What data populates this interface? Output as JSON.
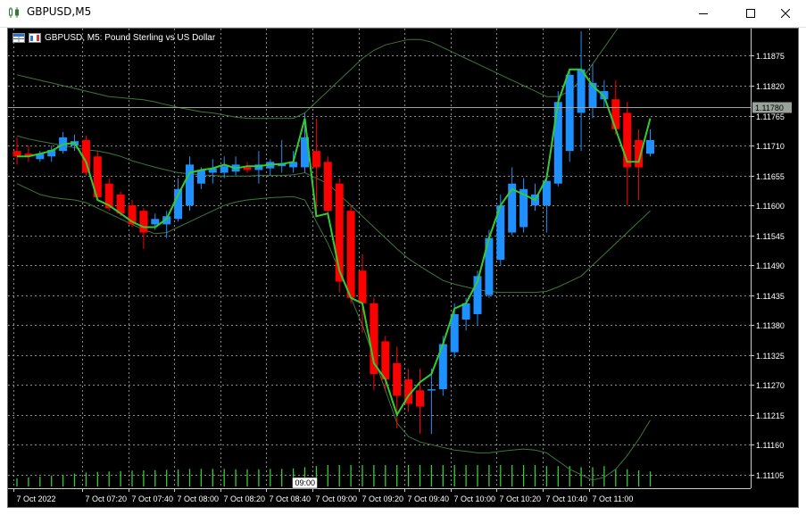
{
  "window": {
    "title": "GBPUSD,M5",
    "minimize_icon": "minimize-icon",
    "maximize_icon": "maximize-icon",
    "close_icon": "close-icon"
  },
  "chart_header": {
    "symbol_text": "GBPUSD, M5:  Pound Sterling vs US Dollar",
    "icons": [
      "trade-panel-icon",
      "one-click-trading-icon"
    ]
  },
  "colors": {
    "background": "#000000",
    "grid": "#8a8a8a",
    "bull": "#1e90ff",
    "bear": "#ff0000",
    "ma": "#32cd32",
    "bands": "#3c783c",
    "volume": "#32cd32",
    "price_line": "#9aa39a",
    "axis_text": "#ffffff"
  },
  "chart_data": {
    "type": "candlestick",
    "symbol": "GBPUSD",
    "timeframe": "M5",
    "current_price": "1.11780",
    "ylim": [
      1.1108,
      1.11925
    ],
    "y_ticks": [
      "1.11875",
      "1.11820",
      "1.11765",
      "1.11710",
      "1.11655",
      "1.11600",
      "1.11545",
      "1.11490",
      "1.11435",
      "1.11380",
      "1.11325",
      "1.11270",
      "1.11215",
      "1.11160",
      "1.11105"
    ],
    "x_ticks": [
      {
        "label": "7 Oct 2022",
        "bar": 0
      },
      {
        "label": "7 Oct 07:20",
        "bar": 6
      },
      {
        "label": "7 Oct 07:40",
        "bar": 10
      },
      {
        "label": "7 Oct 08:00",
        "bar": 14
      },
      {
        "label": "7 Oct 08:20",
        "bar": 18
      },
      {
        "label": "7 Oct 08:40",
        "bar": 22
      },
      {
        "label": "7 Oct 09:00",
        "bar": 26
      },
      {
        "label": "7 Oct 09:20",
        "bar": 30
      },
      {
        "label": "7 Oct 09:40",
        "bar": 34
      },
      {
        "label": "7 Oct 10:00",
        "bar": 38
      },
      {
        "label": "7 Oct 10:20",
        "bar": 42
      },
      {
        "label": "7 Oct 10:40",
        "bar": 46
      },
      {
        "label": "7 Oct 11:00",
        "bar": 50
      }
    ],
    "crosshair_time_label": "09:00",
    "crosshair_bar": 25,
    "candles": [
      {
        "o": 1.117,
        "h": 1.11725,
        "l": 1.11675,
        "c": 1.1169
      },
      {
        "o": 1.11695,
        "h": 1.1171,
        "l": 1.1168,
        "c": 1.1169
      },
      {
        "o": 1.11685,
        "h": 1.117,
        "l": 1.1168,
        "c": 1.11695
      },
      {
        "o": 1.1169,
        "h": 1.1171,
        "l": 1.1168,
        "c": 1.11702
      },
      {
        "o": 1.117,
        "h": 1.11735,
        "l": 1.11695,
        "c": 1.11725
      },
      {
        "o": 1.1171,
        "h": 1.1173,
        "l": 1.117,
        "c": 1.11718
      },
      {
        "o": 1.1172,
        "h": 1.11728,
        "l": 1.11655,
        "c": 1.1166
      },
      {
        "o": 1.1169,
        "h": 1.117,
        "l": 1.1161,
        "c": 1.11615
      },
      {
        "o": 1.1164,
        "h": 1.1165,
        "l": 1.1159,
        "c": 1.11595
      },
      {
        "o": 1.1162,
        "h": 1.11625,
        "l": 1.1158,
        "c": 1.11585
      },
      {
        "o": 1.116,
        "h": 1.1161,
        "l": 1.1156,
        "c": 1.11565
      },
      {
        "o": 1.1159,
        "h": 1.11595,
        "l": 1.1152,
        "c": 1.1155
      },
      {
        "o": 1.11565,
        "h": 1.11585,
        "l": 1.11555,
        "c": 1.11575
      },
      {
        "o": 1.11565,
        "h": 1.1159,
        "l": 1.1154,
        "c": 1.1158
      },
      {
        "o": 1.11575,
        "h": 1.1165,
        "l": 1.1157,
        "c": 1.1163
      },
      {
        "o": 1.116,
        "h": 1.1169,
        "l": 1.1159,
        "c": 1.11675
      },
      {
        "o": 1.1164,
        "h": 1.1167,
        "l": 1.1163,
        "c": 1.11665
      },
      {
        "o": 1.1166,
        "h": 1.11685,
        "l": 1.1164,
        "c": 1.11668
      },
      {
        "o": 1.1166,
        "h": 1.1169,
        "l": 1.1165,
        "c": 1.11672
      },
      {
        "o": 1.11662,
        "h": 1.1169,
        "l": 1.11655,
        "c": 1.11675
      },
      {
        "o": 1.1167,
        "h": 1.1168,
        "l": 1.1166,
        "c": 1.11665
      },
      {
        "o": 1.11665,
        "h": 1.117,
        "l": 1.1164,
        "c": 1.11675
      },
      {
        "o": 1.11668,
        "h": 1.11685,
        "l": 1.11655,
        "c": 1.1168
      },
      {
        "o": 1.11672,
        "h": 1.1172,
        "l": 1.1166,
        "c": 1.11676
      },
      {
        "o": 1.1167,
        "h": 1.117,
        "l": 1.1166,
        "c": 1.1168
      },
      {
        "o": 1.1167,
        "h": 1.1177,
        "l": 1.1166,
        "c": 1.11725
      },
      {
        "o": 1.117,
        "h": 1.1176,
        "l": 1.1158,
        "c": 1.1167
      },
      {
        "o": 1.1168,
        "h": 1.1169,
        "l": 1.11575,
        "c": 1.1159
      },
      {
        "o": 1.1164,
        "h": 1.1165,
        "l": 1.1144,
        "c": 1.1146
      },
      {
        "o": 1.1159,
        "h": 1.116,
        "l": 1.1142,
        "c": 1.1143
      },
      {
        "o": 1.1148,
        "h": 1.1151,
        "l": 1.11365,
        "c": 1.1142
      },
      {
        "o": 1.1142,
        "h": 1.1143,
        "l": 1.1126,
        "c": 1.1129
      },
      {
        "o": 1.1135,
        "h": 1.1136,
        "l": 1.1126,
        "c": 1.1128
      },
      {
        "o": 1.1131,
        "h": 1.1134,
        "l": 1.1119,
        "c": 1.1125
      },
      {
        "o": 1.1128,
        "h": 1.113,
        "l": 1.1122,
        "c": 1.11235
      },
      {
        "o": 1.1126,
        "h": 1.113,
        "l": 1.1118,
        "c": 1.1123
      },
      {
        "o": 1.1126,
        "h": 1.113,
        "l": 1.1118,
        "c": 1.11262
      },
      {
        "o": 1.11262,
        "h": 1.1136,
        "l": 1.1125,
        "c": 1.11345
      },
      {
        "o": 1.1133,
        "h": 1.1142,
        "l": 1.1132,
        "c": 1.114
      },
      {
        "o": 1.1139,
        "h": 1.1143,
        "l": 1.1137,
        "c": 1.1142
      },
      {
        "o": 1.114,
        "h": 1.1148,
        "l": 1.1138,
        "c": 1.1147
      },
      {
        "o": 1.11435,
        "h": 1.11555,
        "l": 1.1143,
        "c": 1.1154
      },
      {
        "o": 1.115,
        "h": 1.1162,
        "l": 1.1149,
        "c": 1.116
      },
      {
        "o": 1.1155,
        "h": 1.1167,
        "l": 1.11545,
        "c": 1.1164
      },
      {
        "o": 1.1156,
        "h": 1.1165,
        "l": 1.1155,
        "c": 1.1163
      },
      {
        "o": 1.116,
        "h": 1.1164,
        "l": 1.1159,
        "c": 1.1162
      },
      {
        "o": 1.116,
        "h": 1.1166,
        "l": 1.1155,
        "c": 1.11645
      },
      {
        "o": 1.1164,
        "h": 1.1181,
        "l": 1.11635,
        "c": 1.1179
      },
      {
        "o": 1.117,
        "h": 1.1185,
        "l": 1.1168,
        "c": 1.1184
      },
      {
        "o": 1.1177,
        "h": 1.1192,
        "l": 1.117,
        "c": 1.1185
      },
      {
        "o": 1.1178,
        "h": 1.1186,
        "l": 1.1176,
        "c": 1.11825
      },
      {
        "o": 1.11795,
        "h": 1.1183,
        "l": 1.1178,
        "c": 1.1181
      },
      {
        "o": 1.11795,
        "h": 1.1183,
        "l": 1.1173,
        "c": 1.1174
      },
      {
        "o": 1.1177,
        "h": 1.1179,
        "l": 1.116,
        "c": 1.1167
      },
      {
        "o": 1.1172,
        "h": 1.1174,
        "l": 1.1161,
        "c": 1.1167
      },
      {
        "o": 1.11695,
        "h": 1.1174,
        "l": 1.1169,
        "c": 1.1172
      }
    ],
    "ma": [
      1.1169,
      1.1169,
      1.11695,
      1.117,
      1.11712,
      1.11715,
      1.1168,
      1.1161,
      1.116,
      1.11585,
      1.1157,
      1.1156,
      1.1156,
      1.11575,
      1.1162,
      1.1166,
      1.11665,
      1.11668,
      1.11675,
      1.11668,
      1.11672,
      1.11672,
      1.11675,
      1.11676,
      1.1168,
      1.1176,
      1.1158,
      1.11585,
      1.1148,
      1.1143,
      1.1142,
      1.1131,
      1.1128,
      1.11215,
      1.1125,
      1.11275,
      1.1129,
      1.11345,
      1.1141,
      1.1142,
      1.1146,
      1.1154,
      1.116,
      1.1163,
      1.1162,
      1.1161,
      1.1165,
      1.1179,
      1.1185,
      1.1185,
      1.1182,
      1.118,
      1.1174,
      1.1168,
      1.1168,
      1.1176
    ],
    "bb_upper": [
      1.1184,
      1.11835,
      1.1183,
      1.11825,
      1.1182,
      1.11815,
      1.1181,
      1.11805,
      1.118,
      1.11798,
      1.11796,
      1.11794,
      1.1179,
      1.11785,
      1.1178,
      1.11776,
      1.11772,
      1.1177,
      1.11766,
      1.11762,
      1.1176,
      1.1176,
      1.1176,
      1.1176,
      1.1176,
      1.1177,
      1.1179,
      1.1181,
      1.1183,
      1.1185,
      1.1187,
      1.11885,
      1.11895,
      1.119,
      1.11905,
      1.11905,
      1.119,
      1.1189,
      1.1188,
      1.1187,
      1.1186,
      1.1185,
      1.1184,
      1.1183,
      1.1182,
      1.1181,
      1.118,
      1.118,
      1.1181,
      1.1183,
      1.1186,
      1.1189,
      1.1192,
      1.1195,
      1.1198,
      1.1201
    ],
    "bb_middle": [
      1.11728,
      1.11722,
      1.11718,
      1.11714,
      1.1171,
      1.11706,
      1.11702,
      1.117,
      1.11696,
      1.1169,
      1.11682,
      1.11676,
      1.1167,
      1.11665,
      1.1166,
      1.11658,
      1.11656,
      1.11655,
      1.11654,
      1.11654,
      1.11654,
      1.11655,
      1.11655,
      1.11655,
      1.11656,
      1.1166,
      1.1165,
      1.1164,
      1.1162,
      1.116,
      1.1158,
      1.1156,
      1.1154,
      1.1152,
      1.11502,
      1.11488,
      1.11475,
      1.11462,
      1.11455,
      1.1145,
      1.11445,
      1.11442,
      1.1144,
      1.1144,
      1.1144,
      1.1144,
      1.11442,
      1.1145,
      1.1146,
      1.1147,
      1.1149,
      1.1151,
      1.1153,
      1.1155,
      1.1157,
      1.1159
    ],
    "bb_lower": [
      1.1164,
      1.1163,
      1.1162,
      1.11615,
      1.11612,
      1.1161,
      1.11605,
      1.11595,
      1.11585,
      1.11575,
      1.11565,
      1.11555,
      1.11548,
      1.1155,
      1.1156,
      1.1157,
      1.1158,
      1.1159,
      1.116,
      1.11606,
      1.1161,
      1.11612,
      1.11614,
      1.11615,
      1.11616,
      1.1161,
      1.1157,
      1.1153,
      1.1148,
      1.1143,
      1.1138,
      1.1132,
      1.1126,
      1.112,
      1.11175,
      1.11165,
      1.1116,
      1.11155,
      1.1115,
      1.11148,
      1.11145,
      1.11145,
      1.11148,
      1.1115,
      1.11152,
      1.1115,
      1.11145,
      1.1113,
      1.11115,
      1.11105,
      1.11095,
      1.111,
      1.11115,
      1.1114,
      1.1117,
      1.11205
    ],
    "volume": [
      0.38,
      0.42,
      0.46,
      0.5,
      0.55,
      0.6,
      0.65,
      0.68,
      0.7,
      0.72,
      0.74,
      0.75,
      0.76,
      0.78,
      0.8,
      0.82,
      0.82,
      0.82,
      0.82,
      0.8,
      0.8,
      0.8,
      0.82,
      0.82,
      0.84,
      0.9,
      0.95,
      1.0,
      1.0,
      1.0,
      1.0,
      1.0,
      1.0,
      1.0,
      1.0,
      1.0,
      1.0,
      1.0,
      1.0,
      1.0,
      1.0,
      1.0,
      1.0,
      1.0,
      1.0,
      1.0,
      0.95,
      0.95,
      0.95,
      0.9,
      0.9,
      0.95,
      0.8,
      0.8,
      0.75,
      0.7
    ]
  }
}
